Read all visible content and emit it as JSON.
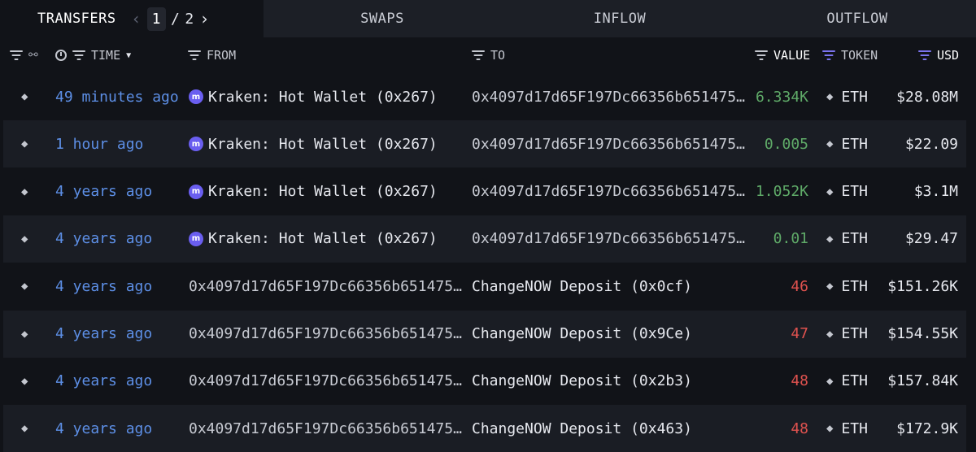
{
  "tabs": {
    "transfers": "TRANSFERS",
    "page_current": "1",
    "page_sep": "/",
    "page_total": "2",
    "swaps": "SWAPS",
    "inflow": "INFLOW",
    "outflow": "OUTFLOW"
  },
  "columns": {
    "time": "TIME",
    "from": "FROM",
    "to": "TO",
    "value": "VALUE",
    "token": "TOKEN",
    "usd": "USD"
  },
  "rows": [
    {
      "time": "49 minutes ago",
      "from": "Kraken: Hot Wallet (0x267)",
      "from_entity": true,
      "to": "0x4097d17d65F197Dc66356b651475…",
      "to_entity": false,
      "value": "6.334K",
      "direction": "in",
      "token": "ETH",
      "usd": "$28.08M"
    },
    {
      "time": "1 hour ago",
      "from": "Kraken: Hot Wallet (0x267)",
      "from_entity": true,
      "to": "0x4097d17d65F197Dc66356b651475…",
      "to_entity": false,
      "value": "0.005",
      "direction": "in",
      "token": "ETH",
      "usd": "$22.09"
    },
    {
      "time": "4 years ago",
      "from": "Kraken: Hot Wallet (0x267)",
      "from_entity": true,
      "to": "0x4097d17d65F197Dc66356b651475…",
      "to_entity": false,
      "value": "1.052K",
      "direction": "in",
      "token": "ETH",
      "usd": "$3.1M"
    },
    {
      "time": "4 years ago",
      "from": "Kraken: Hot Wallet (0x267)",
      "from_entity": true,
      "to": "0x4097d17d65F197Dc66356b651475…",
      "to_entity": false,
      "value": "0.01",
      "direction": "in",
      "token": "ETH",
      "usd": "$29.47"
    },
    {
      "time": "4 years ago",
      "from": "0x4097d17d65F197Dc66356b651475…",
      "from_entity": false,
      "to": "ChangeNOW Deposit (0x0cf)",
      "to_entity": true,
      "value": "46",
      "direction": "out",
      "token": "ETH",
      "usd": "$151.26K"
    },
    {
      "time": "4 years ago",
      "from": "0x4097d17d65F197Dc66356b651475…",
      "from_entity": false,
      "to": "ChangeNOW Deposit (0x9Ce)",
      "to_entity": true,
      "value": "47",
      "direction": "out",
      "token": "ETH",
      "usd": "$154.55K"
    },
    {
      "time": "4 years ago",
      "from": "0x4097d17d65F197Dc66356b651475…",
      "from_entity": false,
      "to": "ChangeNOW Deposit (0x2b3)",
      "to_entity": true,
      "value": "48",
      "direction": "out",
      "token": "ETH",
      "usd": "$157.84K"
    },
    {
      "time": "4 years ago",
      "from": "0x4097d17d65F197Dc66356b651475…",
      "from_entity": false,
      "to": "ChangeNOW Deposit (0x463)",
      "to_entity": true,
      "value": "48",
      "direction": "out",
      "token": "ETH",
      "usd": "$172.9K"
    }
  ],
  "colors": {
    "background": "#111318",
    "row_alt": "#1a1d24",
    "time_link": "#5d8fe6",
    "inflow_value": "#5faa68",
    "outflow_value": "#e0524f",
    "filter_accent": "#7b74f0",
    "kraken_brand": "#6a5ef0"
  },
  "icons": {
    "chain": "ethereum-icon",
    "entity": "kraken-icon",
    "filter": "filter-icon",
    "time": "clock-icon",
    "link": "link-icon"
  }
}
